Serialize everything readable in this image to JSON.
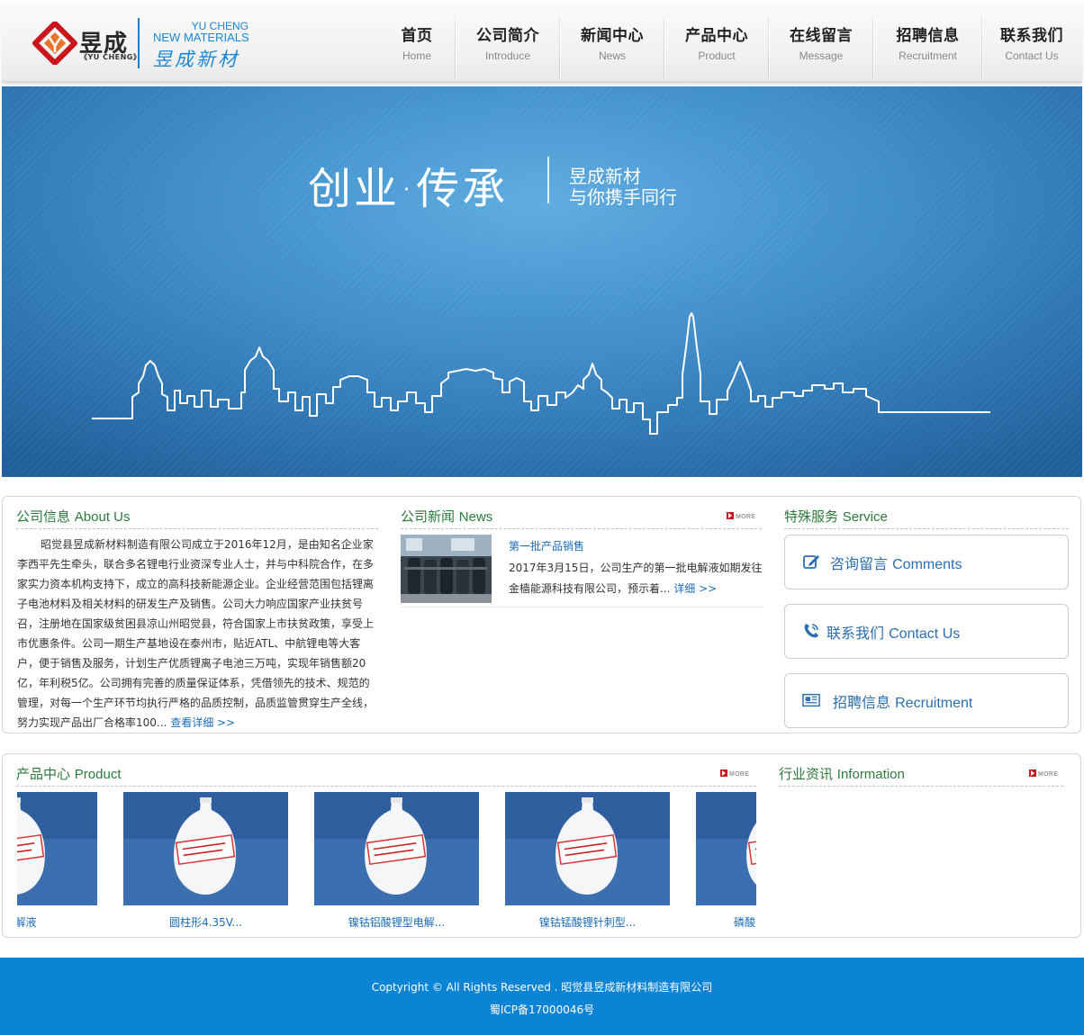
{
  "brand": {
    "name_cn": "昱成",
    "name_sub": "《YU CHENG》",
    "en_line1": "YU CHENG",
    "en_line2": "NEW MATERIALS",
    "cn_line": "昱成新材",
    "colors": {
      "primary": "#1a88d6",
      "logo_red": "#c8161d",
      "logo_orange": "#e8742a"
    }
  },
  "nav": [
    {
      "cn": "首页",
      "en": "Home"
    },
    {
      "cn": "公司简介",
      "en": "Introduce"
    },
    {
      "cn": "新闻中心",
      "en": "News"
    },
    {
      "cn": "产品中心",
      "en": "Product"
    },
    {
      "cn": "在线留言",
      "en": "Message"
    },
    {
      "cn": "招聘信息",
      "en": "Recruitment"
    },
    {
      "cn": "联系我们",
      "en": "Contact Us"
    }
  ],
  "banner": {
    "slogan": "创业·传承",
    "line1": "昱成新材",
    "line2": "与你携手同行"
  },
  "about": {
    "title_cn": "公司信息",
    "title_en": "About Us",
    "text": "昭觉县昱成新材料制造有限公司成立于2016年12月，是由知名企业家李西平先生牵头，联合多名锂电行业资深专业人士，并与中科院合作，在多家实力资本机构支持下，成立的高科技新能源企业。企业经营范围包括锂离子电池材料及相关材料的研发生产及销售。公司大力响应国家产业扶贫号召，注册地在国家级贫困县凉山州昭觉县，符合国家上市扶贫政策，享受上市优惠条件。公司一期生产基地设在泰州市，贴近ATL、中航锂电等大客户，便于销售及服务，计划生产优质锂离子电池三万吨，实现年销售额20亿，年利税5亿。公司拥有完善的质量保证体系，凭借领先的技术、规范的管理，对每一个生产环节均执行严格的品质控制，品质监管贯穿生产全线，努力实现产品出厂合格率100...",
    "more_label": "查看详细 >>"
  },
  "news": {
    "title_cn": "公司新闻",
    "title_en": "News",
    "more": "MORE",
    "items": [
      {
        "title": "第一批产品销售",
        "summary": "2017年3月15日，公司生产的第一批电解液如期发往金樯能源科技有限公司，预示着...",
        "more_label": "详细 >>"
      }
    ]
  },
  "service": {
    "title_cn": "特殊服务",
    "title_en": "Service",
    "items": [
      {
        "cn": "咨询留言",
        "en": "Comments",
        "icon": "edit-icon"
      },
      {
        "cn": "联系我们",
        "en": "Contact Us",
        "icon": "phone-icon"
      },
      {
        "cn": "招聘信息",
        "en": "Recruitment",
        "icon": "newspaper-icon"
      }
    ]
  },
  "products": {
    "title_cn": "产品中心",
    "title_en": "Product",
    "more": "MORE",
    "items": [
      {
        "name": "锂电解液"
      },
      {
        "name": "圆柱形4.35V..."
      },
      {
        "name": "镍钴铝酸锂型电解..."
      },
      {
        "name": "镍钴锰酸锂针刺型..."
      },
      {
        "name": "磷酸"
      }
    ]
  },
  "industry": {
    "title_cn": "行业资讯",
    "title_en": "Information",
    "more": "MORE"
  },
  "footer": {
    "copyright": "Coptyright © All Rights Reserved . 昭觉县昱成新材料制造有限公司",
    "icp": "蜀ICP备17000046号",
    "bg_color": "#0c84d6"
  }
}
